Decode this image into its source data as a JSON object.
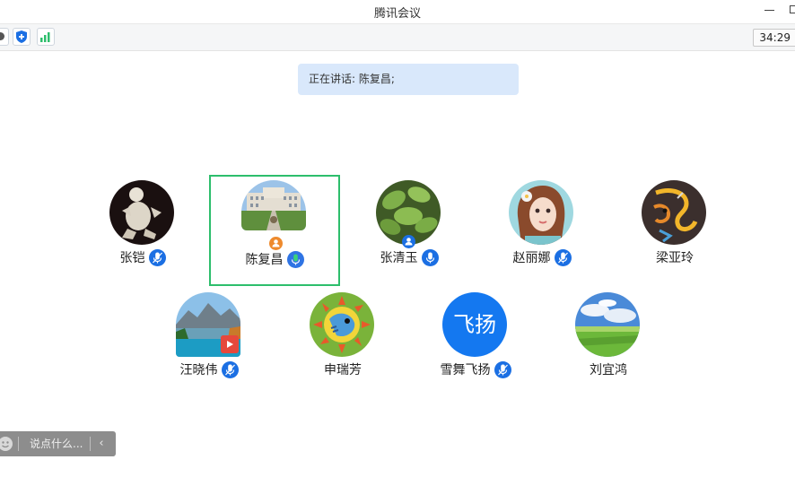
{
  "window": {
    "title": "腾讯会议"
  },
  "toolbar": {
    "timer": "34:29"
  },
  "speaking": {
    "text": "正在讲话: 陈复昌;"
  },
  "participants": [
    {
      "name": "张铠",
      "mic": true
    },
    {
      "name": "陈复昌",
      "mic": true,
      "speaking": true,
      "host": true
    },
    {
      "name": "张清玉",
      "mic": true,
      "cohost": true
    },
    {
      "name": "赵丽娜",
      "mic": true
    },
    {
      "name": "梁亚玲",
      "mic": false
    },
    {
      "name": "汪晓伟",
      "mic": true
    },
    {
      "name": "申瑞芳",
      "mic": false
    },
    {
      "name": "雪舞飞扬",
      "mic": true,
      "avatar_text": "飞扬"
    },
    {
      "name": "刘宜鸿",
      "mic": false
    }
  ],
  "chat": {
    "placeholder": "说点什么..."
  },
  "colors": {
    "accent": "#1b6fe3",
    "active_border": "#2dbe6c",
    "speaking_bg": "#d9e8fb"
  }
}
